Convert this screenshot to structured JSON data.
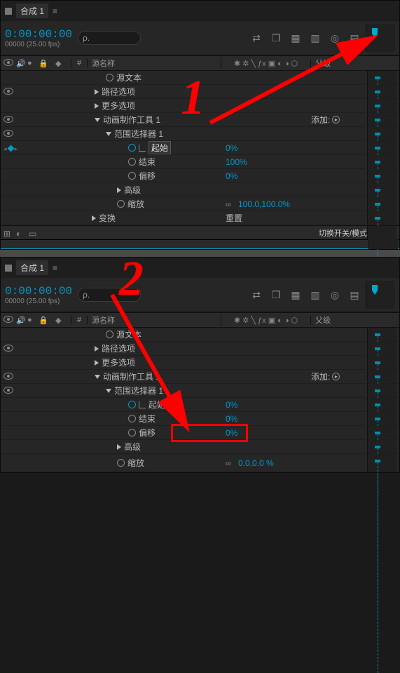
{
  "panels": [
    {
      "tab": "合成 1",
      "timecode": "0:00:00:00",
      "fps": "00000 (25.00 fps)",
      "search_placeholder": "ρ.",
      "columns": {
        "hash": "#",
        "name": "源名称",
        "parent": "父级"
      },
      "rows": {
        "source_text": "源文本",
        "path_opts": "路径选项",
        "more_opts": "更多选项",
        "animator": "动画制作工具 1",
        "add_label": "添加:",
        "range_sel": "范围选择器 1",
        "start": "起始",
        "start_val": "0%",
        "end": "结束",
        "end_val": "100%",
        "offset": "偏移",
        "offset_val": "0%",
        "advanced": "高级",
        "scale": "缩放",
        "scale_val": "100.0,100.0%",
        "transform": "变换",
        "transform_val": "重置"
      },
      "footer": "切换开关/模式"
    },
    {
      "tab": "合成 1",
      "timecode": "0:00:00:00",
      "fps": "00000 (25.00 fps)",
      "search_placeholder": "ρ.",
      "columns": {
        "hash": "#",
        "name": "源名称",
        "parent": "父级"
      },
      "rows": {
        "source_text": "源文本",
        "path_opts": "路径选项",
        "more_opts": "更多选项",
        "animator": "动画制作工具 1",
        "add_label": "添加:",
        "range_sel": "范围选择器 1",
        "start": "起始",
        "start_val": "0%",
        "end": "结束",
        "end_val": "0%",
        "offset": "偏移",
        "offset_val": "0%",
        "advanced": "高级",
        "scale": "缩放",
        "scale_val": "0.0,0.0 %"
      }
    }
  ],
  "annotations": {
    "one": "1",
    "two": "2"
  }
}
